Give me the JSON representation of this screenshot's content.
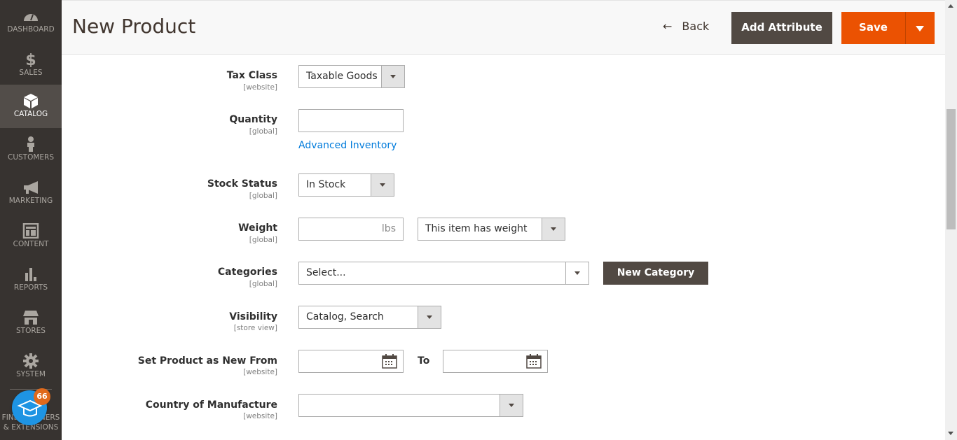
{
  "sidebar": {
    "items": [
      {
        "label": "DASHBOARD",
        "icon": "dashboard-icon",
        "active": false
      },
      {
        "label": "SALES",
        "icon": "dollar-icon",
        "active": false
      },
      {
        "label": "CATALOG",
        "icon": "box-icon",
        "active": true
      },
      {
        "label": "CUSTOMERS",
        "icon": "person-icon",
        "active": false
      },
      {
        "label": "MARKETING",
        "icon": "megaphone-icon",
        "active": false
      },
      {
        "label": "CONTENT",
        "icon": "layout-icon",
        "active": false
      },
      {
        "label": "REPORTS",
        "icon": "bar-chart-icon",
        "active": false
      },
      {
        "label": "STORES",
        "icon": "storefront-icon",
        "active": false
      },
      {
        "label": "SYSTEM",
        "icon": "gear-icon",
        "active": false
      }
    ],
    "partners_label_1": "FIND PARTNERS",
    "partners_label_2": "& EXTENSIONS",
    "learn_badge": "66"
  },
  "header": {
    "title": "New Product",
    "back_label": "Back",
    "add_attribute_label": "Add Attribute",
    "save_label": "Save"
  },
  "form": {
    "tax_class": {
      "label": "Tax Class",
      "scope": "[website]",
      "value": "Taxable Goods"
    },
    "quantity": {
      "label": "Quantity",
      "scope": "[global]",
      "value": "",
      "advanced_link": "Advanced Inventory"
    },
    "stock_status": {
      "label": "Stock Status",
      "scope": "[global]",
      "value": "In Stock"
    },
    "weight": {
      "label": "Weight",
      "scope": "[global]",
      "value": "",
      "unit": "lbs",
      "type_value": "This item has weight"
    },
    "categories": {
      "label": "Categories",
      "scope": "[global]",
      "value": "Select...",
      "new_button": "New Category"
    },
    "visibility": {
      "label": "Visibility",
      "scope": "[store view]",
      "value": "Catalog, Search"
    },
    "new_from": {
      "label": "Set Product as New From",
      "scope": "[website]",
      "from_value": "",
      "to_label": "To",
      "to_value": ""
    },
    "country": {
      "label": "Country of Manufacture",
      "scope": "[website]",
      "value": ""
    }
  },
  "colors": {
    "accent": "#eb5202",
    "dark_button": "#514943",
    "sidebar_bg": "#373330",
    "link": "#007bdb"
  }
}
